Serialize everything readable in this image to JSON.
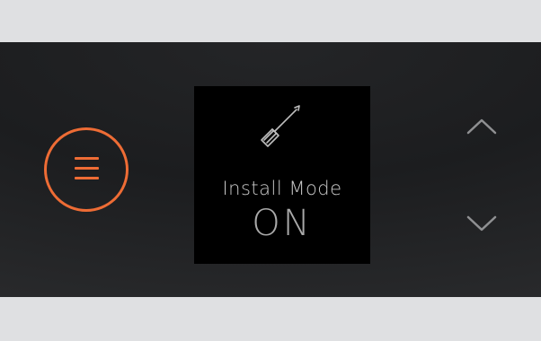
{
  "screen": {
    "title": "Install Mode",
    "state": "ON"
  },
  "icons": {
    "menu": "menu-icon",
    "tool": "screwdriver-icon",
    "up": "chevron-up-icon",
    "down": "chevron-down-icon"
  },
  "colors": {
    "accent": "#ee6c35",
    "panel": "#1e1f21",
    "screen": "#000000",
    "text": "#c9c9c9",
    "background": "#dfe0e2"
  }
}
